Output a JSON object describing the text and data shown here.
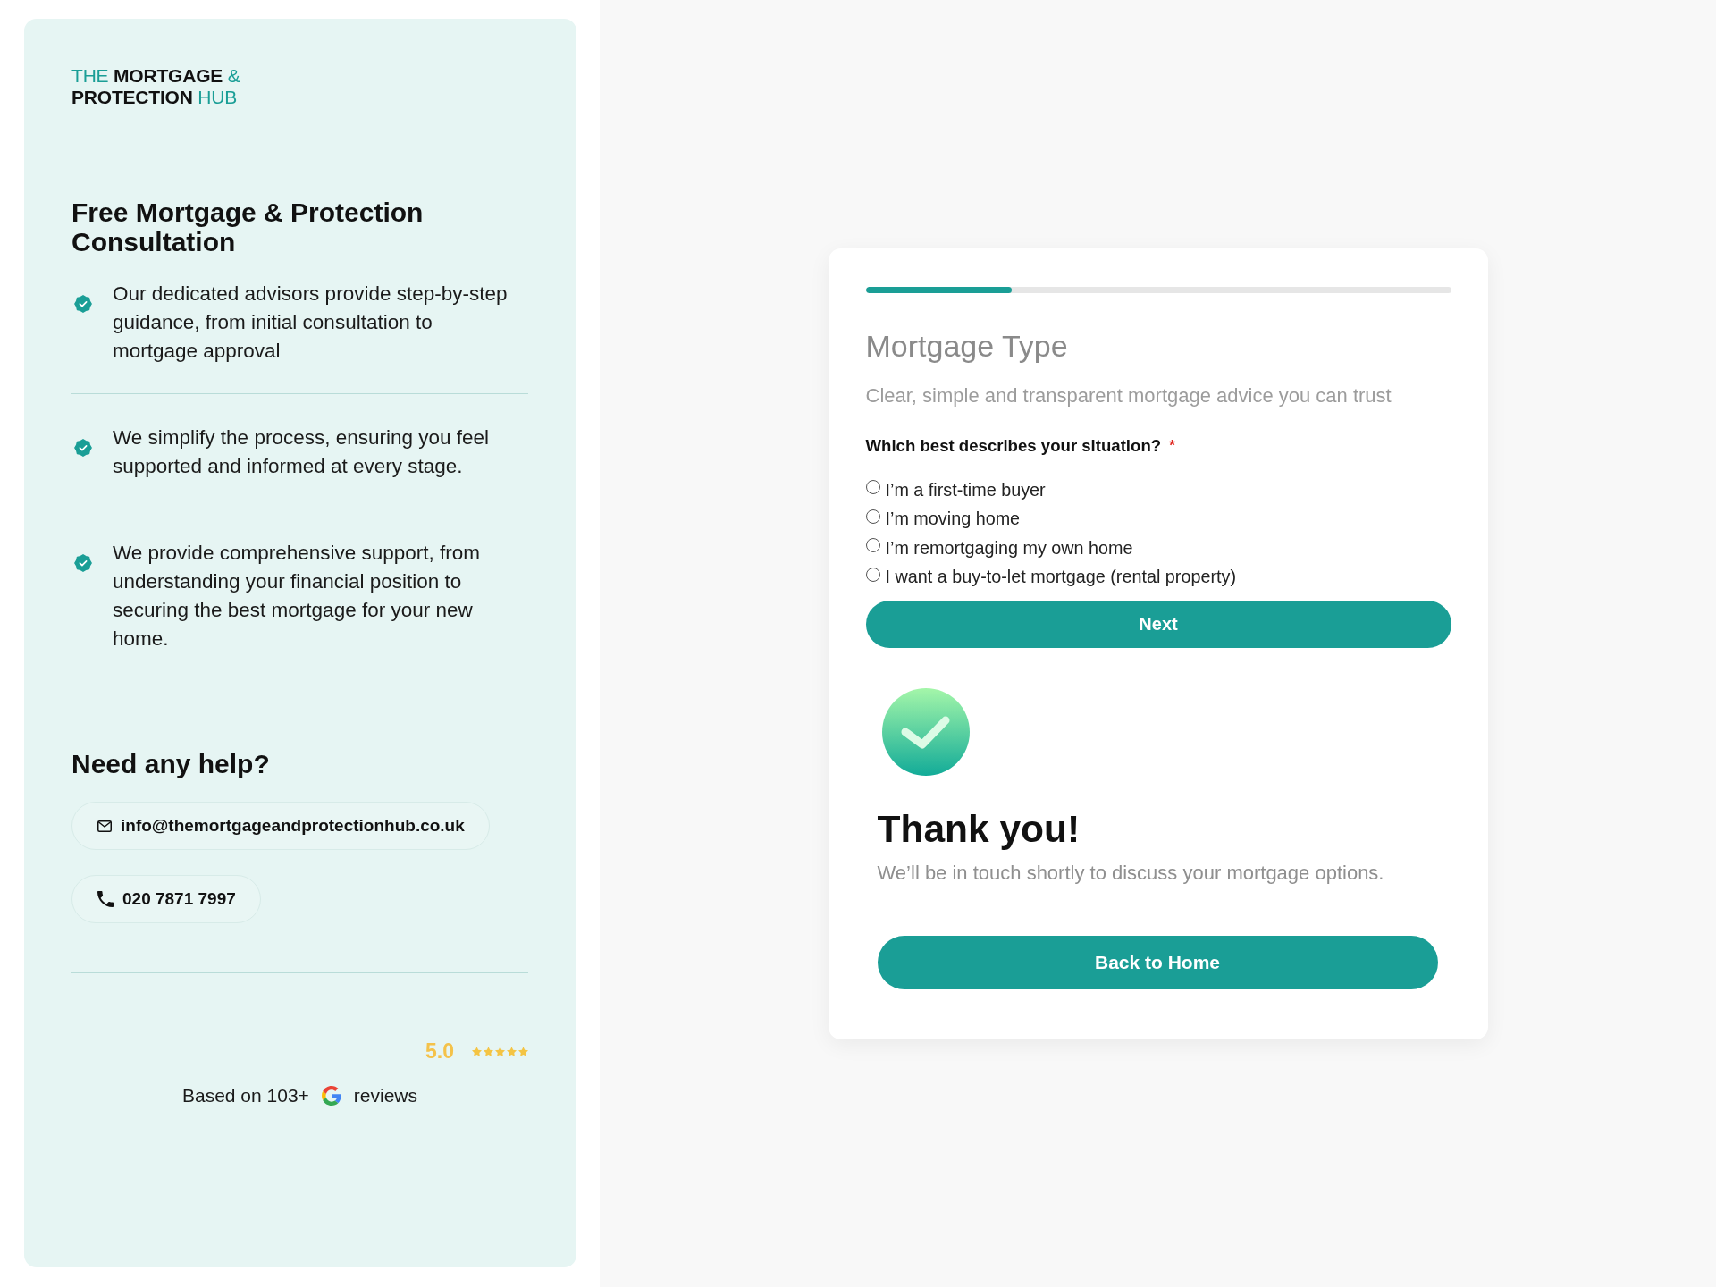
{
  "logo": {
    "lines": [
      {
        "parts": [
          {
            "text": "THE",
            "kind": "accent"
          },
          {
            "text": "MORTGAGE",
            "kind": "strong"
          },
          {
            "text": "&",
            "kind": "accent"
          }
        ]
      },
      {
        "parts": [
          {
            "text": "PROTECTION",
            "kind": "strong"
          },
          {
            "text": "HUB",
            "kind": "accent"
          }
        ]
      }
    ]
  },
  "intro": {
    "title": "Free Mortgage & Protection Consultation",
    "features": [
      {
        "text": "Our dedicated advisors provide step-by-step guidance, from initial consultation to mortgage approval"
      },
      {
        "text": "We simplify the process, ensuring you feel supported and informed at every stage."
      },
      {
        "text": "We provide comprehensive support, from understanding your financial position to securing the best mortgage for your new home."
      }
    ]
  },
  "help": {
    "title": "Need any help?",
    "contacts": [
      {
        "kind": "email",
        "text": "info@themortgageandprotectionhub.co.uk"
      },
      {
        "kind": "phone",
        "text": "020 7871 7997"
      }
    ]
  },
  "rating": {
    "score": "5.0",
    "stars": 5,
    "text_before": "Based on 103+",
    "text_after": "reviews"
  },
  "form": {
    "progress": {
      "level": 0.25
    },
    "title": "Mortgage Type",
    "subtitle": "Clear, simple and transparent mortgage advice you can trust",
    "question": {
      "label": "Which best describes your situation?",
      "required_mark": "*",
      "options": [
        {
          "label": "I’m a first-time buyer",
          "selected": false
        },
        {
          "label": "I’m moving home",
          "selected": false
        },
        {
          "label": "I’m remortgaging my own home",
          "selected": false
        },
        {
          "label": "I want a buy-to-let mortgage (rental property)",
          "selected": false
        }
      ]
    },
    "next_button": "Next"
  },
  "confirmation": {
    "title": "Thank you!",
    "message": "We’ll be in touch shortly to discuss your mortgage options.",
    "button": "Back to Home"
  }
}
